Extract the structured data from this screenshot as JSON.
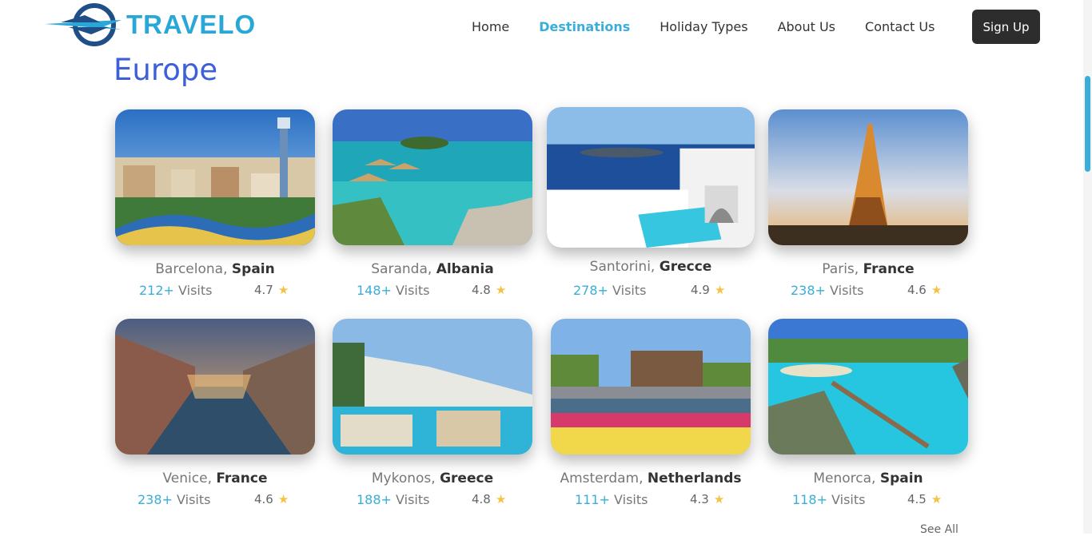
{
  "brand": {
    "name": "TRAVELO",
    "color": "#29a8d8"
  },
  "nav": {
    "items": [
      "Home",
      "Destinations",
      "Holiday Types",
      "About Us",
      "Contact Us"
    ],
    "active": "Destinations",
    "signup_label": "Sign Up"
  },
  "section": {
    "title": "Europe",
    "see_all": "See All"
  },
  "destinations": [
    {
      "city": "Barcelona,",
      "country": "Spain",
      "visits_count": "212+",
      "visits_label": "Visits",
      "rating": "4.7"
    },
    {
      "city": "Saranda,",
      "country": "Albania",
      "visits_count": "148+",
      "visits_label": "Visits",
      "rating": "4.8"
    },
    {
      "city": "Santorini,",
      "country": "Grecce",
      "visits_count": "278+",
      "visits_label": "Visits",
      "rating": "4.9"
    },
    {
      "city": "Paris,",
      "country": "France",
      "visits_count": "238+",
      "visits_label": "Visits",
      "rating": "4.6"
    },
    {
      "city": "Venice,",
      "country": "France",
      "visits_count": "238+",
      "visits_label": "Visits",
      "rating": "4.6"
    },
    {
      "city": "Mykonos,",
      "country": "Greece",
      "visits_count": "188+",
      "visits_label": "Visits",
      "rating": "4.8"
    },
    {
      "city": "Amsterdam,",
      "country": "Netherlands",
      "visits_count": "111+",
      "visits_label": "Visits",
      "rating": "4.3"
    },
    {
      "city": "Menorca,",
      "country": "Spain",
      "visits_count": "118+",
      "visits_label": "Visits",
      "rating": "4.5"
    }
  ],
  "icons": {
    "star": "star-icon",
    "logo": "plane-logo-icon"
  },
  "colors": {
    "accent": "#3aaed8",
    "title": "#3d5fd8",
    "star": "#f5c242",
    "button": "#2d2d2d"
  }
}
